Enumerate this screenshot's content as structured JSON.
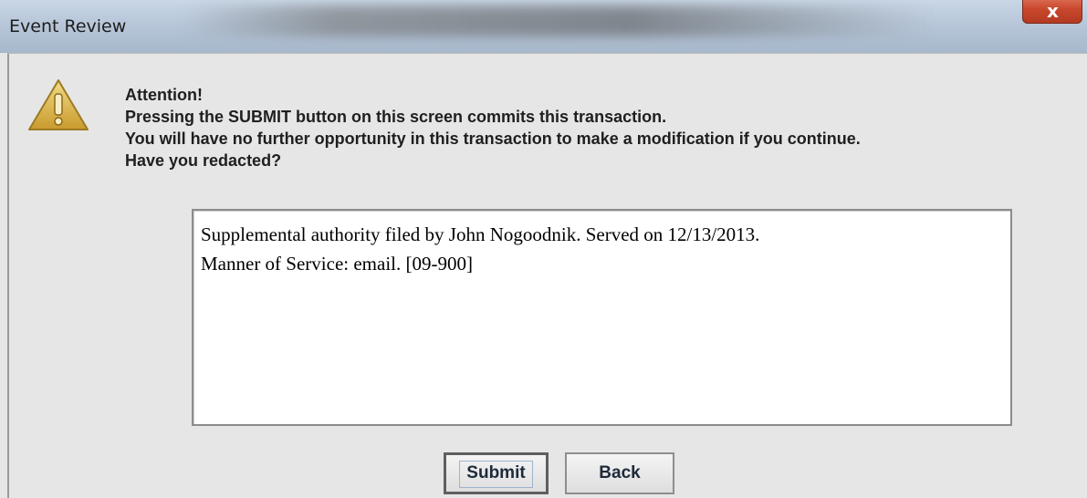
{
  "window": {
    "title": "Event Review",
    "close_glyph": "x"
  },
  "dialog": {
    "icon": "warning-icon",
    "message_lines": [
      "Attention!",
      "Pressing the SUBMIT button on this screen commits this transaction.",
      "You will have no further opportunity in this transaction to make a modification if you continue.",
      "Have you redacted?"
    ],
    "text_area_lines": [
      "Supplemental authority filed by John Nogoodnik. Served on 12/13/2013.",
      "Manner of Service: email. [09-900]"
    ],
    "buttons": {
      "submit": "Submit",
      "back": "Back"
    }
  },
  "colors": {
    "background": "#e6e6e6",
    "close_button": "#c9482d",
    "warning_fill": "#d9b64a"
  }
}
